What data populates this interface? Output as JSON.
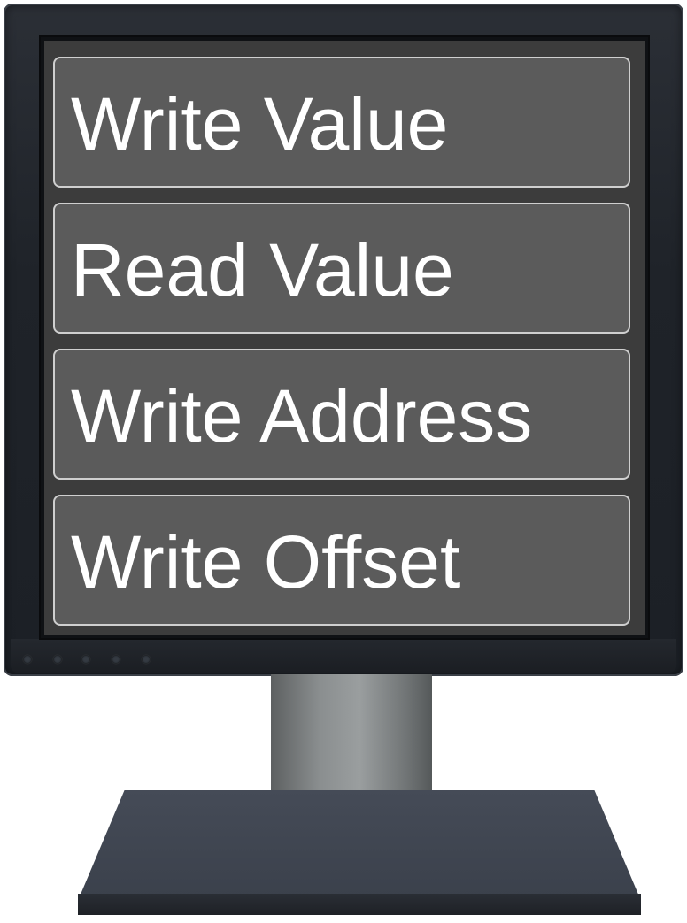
{
  "screen": {
    "menu": [
      {
        "label": "Write Value"
      },
      {
        "label": "Read Value"
      },
      {
        "label": "Write Address"
      },
      {
        "label": "Write Offset"
      }
    ]
  },
  "colors": {
    "button_fill": "#5b5b5b",
    "button_border": "#cfcfcf",
    "button_text": "#ffffff",
    "screen_background": "#3c3c3c",
    "bezel": "#1f2329"
  },
  "icons": [
    "monitor-power-button-icon",
    "monitor-control-button-icon"
  ]
}
